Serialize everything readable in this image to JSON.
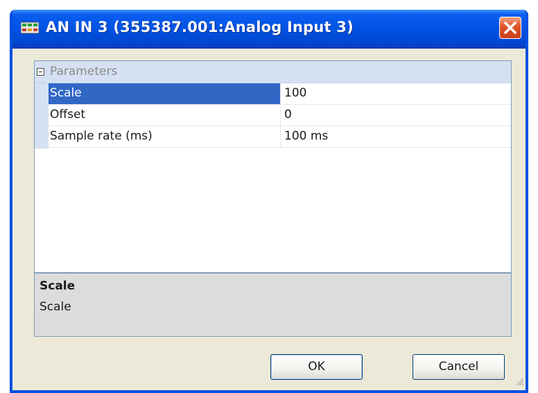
{
  "window": {
    "title": "AN IN 3 (355387.001:Analog Input 3)",
    "icon": "app-module-icon",
    "close_icon": "close-icon"
  },
  "property_grid": {
    "category": "Parameters",
    "rows": [
      {
        "name": "Scale",
        "value": "100",
        "selected": true
      },
      {
        "name": "Offset",
        "value": "0",
        "selected": false
      },
      {
        "name": "Sample rate (ms)",
        "value": "100 ms",
        "selected": false
      }
    ]
  },
  "description": {
    "title": "Scale",
    "text": "Scale"
  },
  "buttons": {
    "ok": "OK",
    "cancel": "Cancel"
  },
  "colors": {
    "titlebar": "#0052e2",
    "selection": "#3168c6",
    "close": "#e0542a"
  }
}
